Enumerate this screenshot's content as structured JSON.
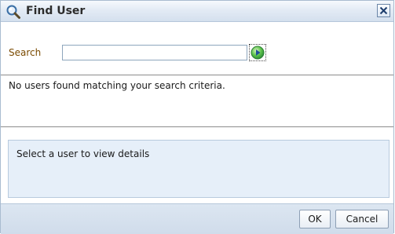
{
  "dialog": {
    "title": "Find User",
    "icons": {
      "title": "search-icon",
      "close": "close-icon",
      "go": "go-arrow-icon"
    }
  },
  "search": {
    "label": "Search",
    "value": "",
    "placeholder": ""
  },
  "results": {
    "message": "No users found matching your search criteria."
  },
  "details": {
    "message": "Select a user to view details"
  },
  "footer": {
    "ok_label": "OK",
    "cancel_label": "Cancel"
  },
  "colors": {
    "label": "#7a4a00",
    "details_bg": "#e6eff9",
    "footer_bg": "#d6e1ee",
    "go_button": "#36a93a"
  }
}
